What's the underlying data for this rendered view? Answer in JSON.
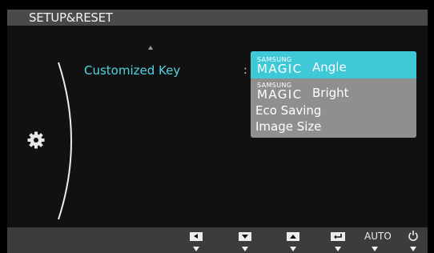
{
  "osd": {
    "title": "SETUP&RESET",
    "menu_item": "Customized Key",
    "separator": ":",
    "options": [
      {
        "brand_top": "SAMSUNG",
        "brand_main": "MAGIC",
        "label": "Angle",
        "selected": true
      },
      {
        "brand_top": "SAMSUNG",
        "brand_main": "MAGIC",
        "label": "Bright",
        "selected": false
      },
      {
        "label": "Eco Saving",
        "selected": false
      },
      {
        "label": "Image Size",
        "selected": false
      }
    ]
  },
  "icons": {
    "menu_category": "gear-icon",
    "scroll_up": "triangle-up-icon"
  },
  "bottom_bar": {
    "auto_label": "AUTO",
    "keys": [
      "left-key-icon",
      "down-key-icon",
      "up-key-icon",
      "enter-key-icon",
      "auto-key",
      "power-icon"
    ]
  },
  "colors": {
    "highlight": "#3fc8d8",
    "menu_text": "#4fd5e4",
    "submenu_bg": "#8f8f8f",
    "title_bar": "#4a4a4a"
  }
}
